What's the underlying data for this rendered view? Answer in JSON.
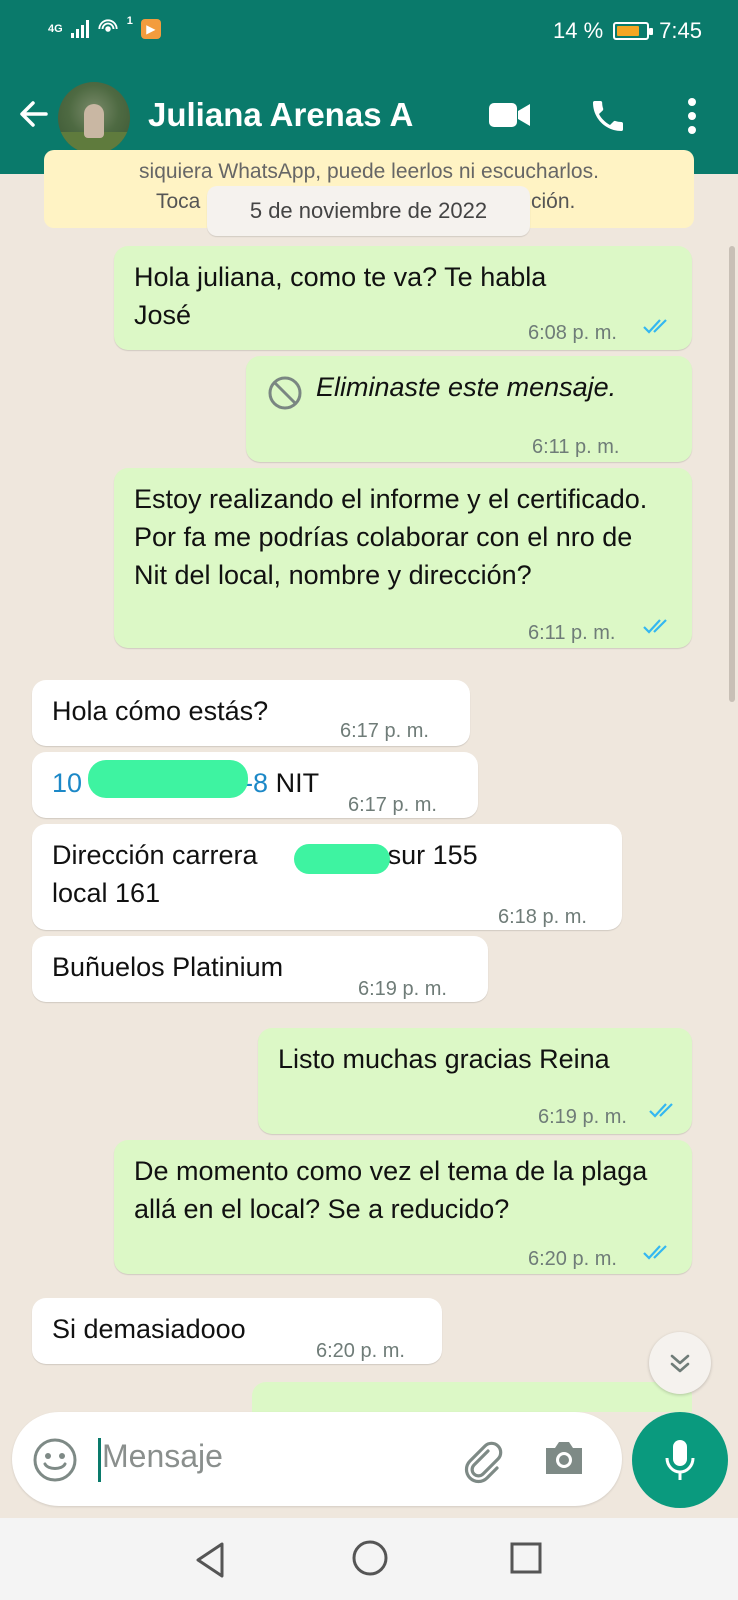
{
  "status_bar": {
    "network": "4G",
    "notification_count": "1",
    "battery_percent": "14 %",
    "time": "7:45",
    "battery_level": 0.14
  },
  "header": {
    "contact_name": "Juliana Arenas A",
    "icons": [
      "back-arrow-icon",
      "video-call-icon",
      "voice-call-icon",
      "more-options-icon"
    ]
  },
  "system_notice": {
    "line1": "siquiera WhatsApp, puede leerlos ni escucharlos.",
    "line2_start": "Toca",
    "line2_end": "ción."
  },
  "date_chip": "5 de noviembre de 2022",
  "messages": [
    {
      "dir": "out",
      "text": "Hola juliana, como te va? Te habla\nJosé",
      "time": "6:08 p. m.",
      "read": true
    },
    {
      "dir": "out",
      "text": "Eliminaste este mensaje.",
      "time": "6:11 p. m.",
      "deleted": true
    },
    {
      "dir": "out",
      "text": "Estoy realizando el informe y el certificado. Por fa me podrías colaborar con el nro de Nit del local, nombre y dirección?",
      "time": "6:11 p. m.",
      "read": true
    },
    {
      "dir": "in",
      "text": "Hola cómo estás?",
      "time": "6:17 p. m."
    },
    {
      "dir": "in",
      "text_prefix": "10",
      "text_mid": "1-8",
      "text_suffix": " NIT",
      "time": "6:17 p. m."
    },
    {
      "dir": "in",
      "text_a": "Dirección carrera",
      "text_b": "A sur 155",
      "text_c": "local 161",
      "time": "6:18 p. m."
    },
    {
      "dir": "in",
      "text": "Buñuelos Platinium",
      "time": "6:19 p. m."
    },
    {
      "dir": "out",
      "text": "Listo muchas gracias Reina",
      "time": "6:19 p. m.",
      "read": true
    },
    {
      "dir": "out",
      "text": "De momento como vez el tema de la plaga allá en el local? Se a reducido?",
      "time": "6:20 p. m.",
      "read": true
    },
    {
      "dir": "in",
      "text": "Si demasiadooo",
      "time": "6:20 p. m."
    }
  ],
  "composer": {
    "placeholder": "Mensaje",
    "icons": [
      "emoji-icon",
      "attach-icon",
      "camera-icon",
      "mic-icon"
    ]
  },
  "colors": {
    "header": "#0a7a6b",
    "outgoing_bubble": "#dcf8c6",
    "incoming_bubble": "#ffffff",
    "background": "#efe7dd",
    "read_ticks": "#34b7f1",
    "fab": "#0a9a7e"
  }
}
